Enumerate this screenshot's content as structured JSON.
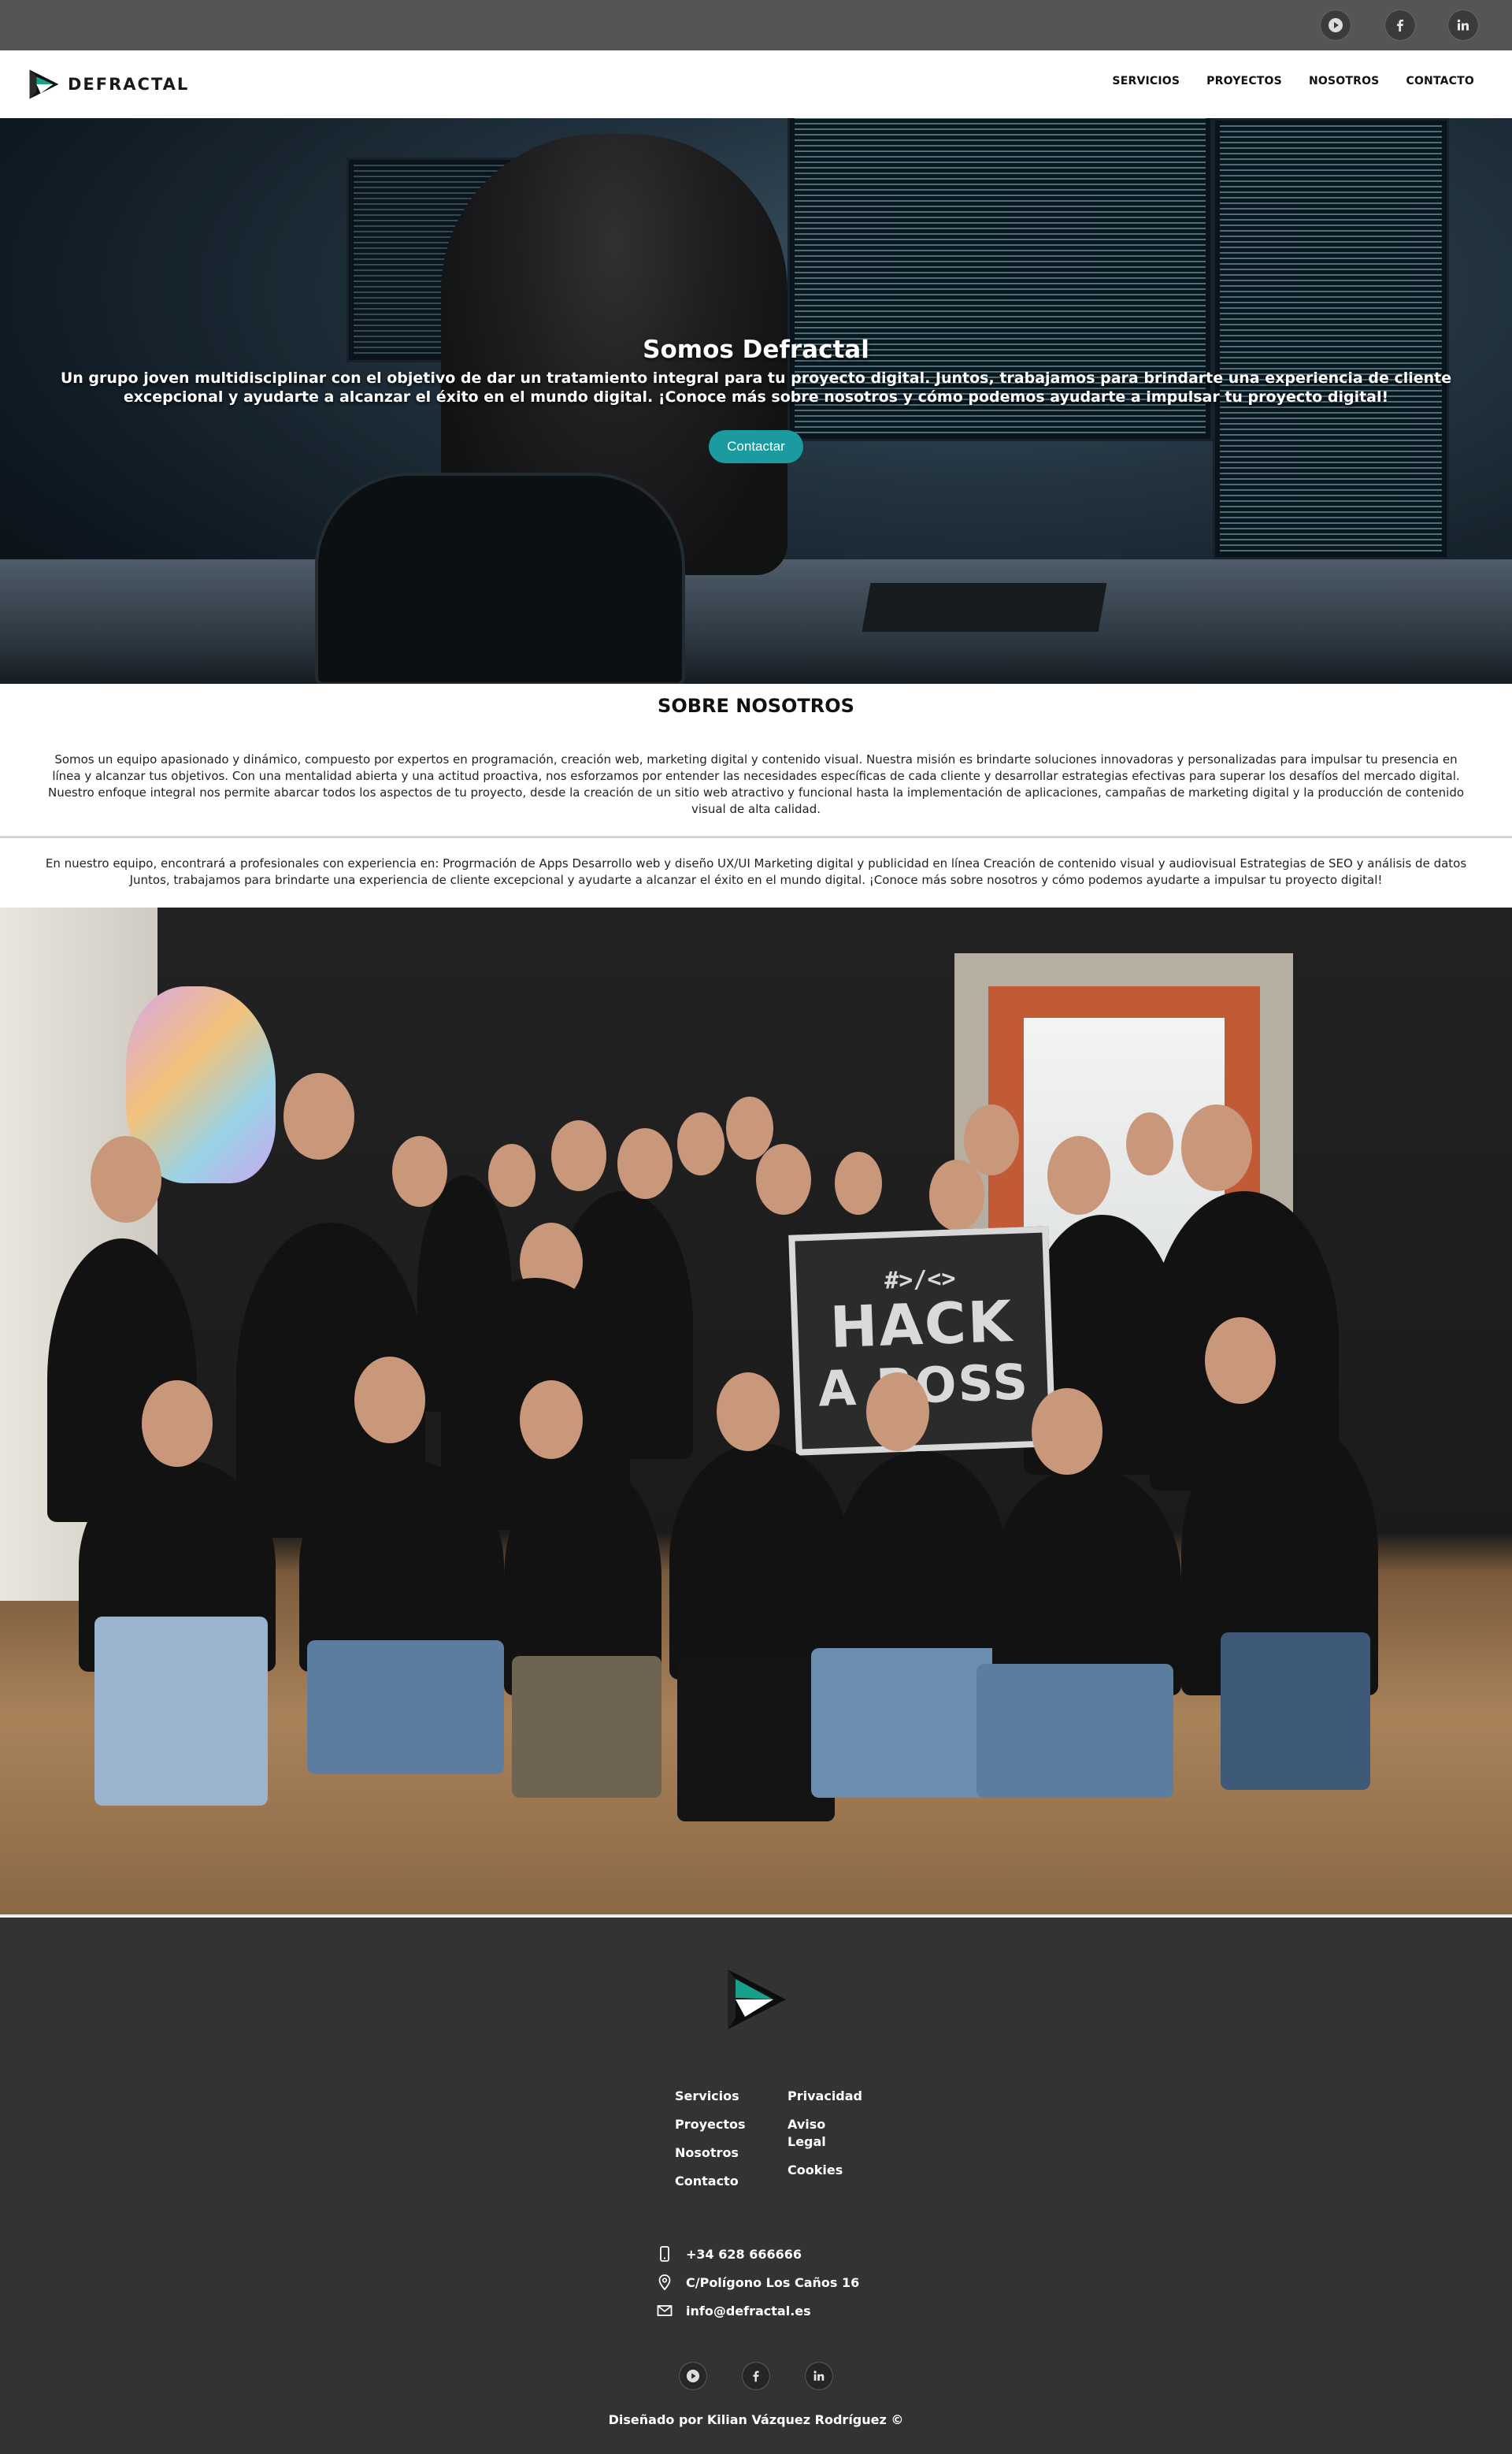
{
  "social": {
    "items": [
      {
        "name": "youtube"
      },
      {
        "name": "facebook"
      },
      {
        "name": "linkedin"
      }
    ]
  },
  "nav": {
    "brand": "DEFRACTAL",
    "links": [
      "SERVICIOS",
      "PROYECTOS",
      "NOSOTROS",
      "CONTACTO"
    ]
  },
  "hero": {
    "title": "Somos Defractal",
    "subtitle": "Un grupo joven multidisciplinar con el objetivo de dar un tratamiento integral para tu proyecto digital. Juntos, trabajamos para brindarte una experiencia de cliente excepcional y ayudarte a alcanzar el éxito en el mundo digital. ¡Conoce más sobre nosotros y cómo podemos ayudarte a impulsar tu proyecto digital!",
    "button": "Contactar"
  },
  "about": {
    "title": "SOBRE NOSOTROS",
    "paragraph1": "Somos un equipo apasionado y dinámico, compuesto por expertos en programación, creación web, marketing digital y contenido visual. Nuestra misión es brindarte soluciones innovadoras y personalizadas para impulsar tu presencia en línea y alcanzar tus objetivos. Con una mentalidad abierta y una actitud proactiva, nos esforzamos por entender las necesidades específicas de cada cliente y desarrollar estrategias efectivas para superar los desafíos del mercado digital. Nuestro enfoque integral nos permite abarcar todos los aspectos de tu proyecto, desde la creación de un sitio web atractivo y funcional hasta la implementación de aplicaciones, campañas de marketing digital y la producción de contenido visual de alta calidad.",
    "paragraph2": "En nuestro equipo, encontrará a profesionales con experiencia en: Progrmación de Apps Desarrollo web y diseño UX/UI Marketing digital y publicidad en línea Creación de contenido visual y audiovisual Estrategias de SEO y análisis de datos Juntos, trabajamos para brindarte una experiencia de cliente excepcional y ayudarte a alcanzar el éxito en el mundo digital. ¡Conoce más sobre nosotros y cómo podemos ayudarte a impulsar tu proyecto digital!"
  },
  "team_photo": {
    "sign_tag": "#>/<>",
    "sign_line1": "HACK",
    "sign_line2": "A BOSS"
  },
  "footer": {
    "col1": [
      "Servicios",
      "Proyectos",
      "Nosotros",
      "Contacto"
    ],
    "col2": [
      "Privacidad",
      "Aviso Legal",
      "Cookies"
    ],
    "phone": "+34 628 666666",
    "address": "C/Polígono Los Caños 16",
    "email": "info@defractal.es",
    "credit": "Diseñado por Kilian Vázquez Rodríguez ©"
  },
  "colors": {
    "topbar": "#555555",
    "accent": "#1b9aa0",
    "footer": "#333333",
    "logo_teal": "#19a08a"
  },
  "icons": [
    "youtube-icon",
    "facebook-icon",
    "linkedin-icon",
    "phone-icon",
    "location-icon",
    "mail-icon"
  ]
}
